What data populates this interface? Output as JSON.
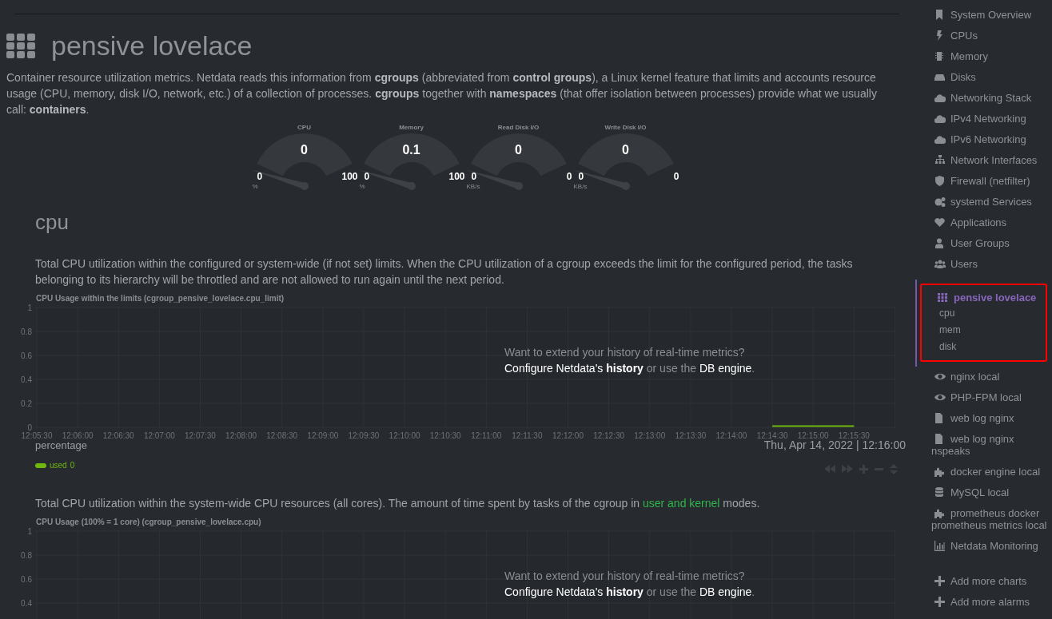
{
  "header": {
    "title": "pensive lovelace",
    "description": "Container resource utilization metrics. Netdata reads this information from **cgroups** (abbreviated from **control groups**), a Linux kernel feature that limits and accounts resource usage (CPU, memory, disk I/O, network, etc.) of a collection of processes. **cgroups** together with **namespaces** (that offer isolation between processes) provide what we usually call: **containers**."
  },
  "gauges": [
    {
      "title": "CPU",
      "value": "0",
      "min": "0",
      "max": "100",
      "unit": "%"
    },
    {
      "title": "Memory",
      "value": "0.1",
      "min": "0",
      "max": "100",
      "unit": "%"
    },
    {
      "title": "Read Disk I/O",
      "value": "0",
      "min": "0",
      "max": "0",
      "unit": "KB/s"
    },
    {
      "title": "Write Disk I/O",
      "value": "0",
      "min": "0",
      "max": "0",
      "unit": "KB/s"
    }
  ],
  "section": {
    "heading": "cpu"
  },
  "charts": [
    {
      "intro": {
        "text": "Total CPU utilization within the configured or system-wide (if not set) limits. When the CPU utilization of a cgroup exceeds the limit for the configured period, the tasks belonging to its hierarchy will be throttled and are not allowed to run again until the next period."
      },
      "history_notice": {
        "question": "Want to extend your history of real-time metrics?",
        "link_1": "Configure Netdata's **history**",
        "middle": " or use the ",
        "link_2": "DB engine",
        "end": "."
      },
      "units": "percentage",
      "timestamp": "Thu, Apr 14, 2022 | 12:16:00",
      "legend": [
        {
          "value": "0"
        }
      ],
      "chart_data": {
        "type": "line",
        "title": "CPU Usage within the limits (cgroup_pensive_lovelace.cpu_limit)",
        "categories": [
          "12:05:30",
          "12:06:00",
          "12:06:30",
          "12:07:00",
          "12:07:30",
          "12:08:00",
          "12:08:30",
          "12:09:00",
          "12:09:30",
          "12:10:00",
          "12:10:30",
          "12:11:00",
          "12:11:30",
          "12:12:00",
          "12:12:30",
          "12:13:00",
          "12:13:30",
          "12:14:00",
          "12:14:30",
          "12:15:00",
          "12:15:30"
        ],
        "series": [
          {
            "name": "used",
            "color": "#6fb70f",
            "values": [
              null,
              null,
              null,
              null,
              null,
              null,
              null,
              null,
              null,
              null,
              null,
              null,
              null,
              null,
              null,
              null,
              null,
              null,
              0,
              0,
              0
            ]
          }
        ],
        "ylim": [
          0,
          1
        ],
        "yticks": [
          0,
          0.2,
          0.4,
          0.6,
          0.8,
          1
        ],
        "grid": true
      }
    },
    {
      "intro": {
        "before": "Total CPU utilization within the system-wide CPU resources (all cores). The amount of time spent by tasks of the cgroup in ",
        "link": "user and kernel",
        "after": " modes."
      },
      "history_notice": {
        "question": "Want to extend your history of real-time metrics?",
        "link_1": "Configure Netdata's **history**",
        "middle": " or use the ",
        "link_2": "DB engine",
        "end": "."
      },
      "chart_title": "CPU Usage (100% = 1 core) (cgroup_pensive_lovelace.cpu)",
      "axis_labels": [
        "1",
        "0.8",
        "0.6",
        "0.4"
      ]
    }
  ],
  "sidebar": {
    "items": [
      {
        "label": "System Overview",
        "kind": "bookmark",
        "selected": false
      },
      {
        "label": "CPUs",
        "kind": "bolt",
        "selected": false
      },
      {
        "label": "Memory",
        "kind": "chip",
        "selected": false
      },
      {
        "label": "Disks",
        "kind": "drive",
        "selected": false
      },
      {
        "label": "Networking Stack",
        "kind": "cloud",
        "selected": false
      },
      {
        "label": "IPv4 Networking",
        "kind": "cloud",
        "selected": false
      },
      {
        "label": "IPv6 Networking",
        "kind": "cloud",
        "selected": false
      },
      {
        "label": "Network Interfaces",
        "kind": "sitemap",
        "selected": false
      },
      {
        "label": "Firewall (netfilter)",
        "kind": "shield",
        "selected": false
      },
      {
        "label": "systemd Services",
        "kind": "gears",
        "selected": false
      },
      {
        "label": "Applications",
        "kind": "heart",
        "selected": false
      },
      {
        "label": "User Groups",
        "kind": "user",
        "selected": false
      },
      {
        "label": "Users",
        "kind": "users",
        "selected": false
      },
      {
        "label": "pensive lovelace",
        "kind": "grid",
        "selected": true,
        "highlighted": true,
        "children": [
          {
            "label": "cpu"
          },
          {
            "label": "mem"
          },
          {
            "label": "disk"
          }
        ]
      },
      {
        "label": "nginx local",
        "kind": "eye",
        "selected": false
      },
      {
        "label": "PHP-FPM local",
        "kind": "eye",
        "selected": false
      },
      {
        "label": "web log nginx",
        "kind": "file",
        "selected": false
      },
      {
        "label": "web log nginx nspeaks",
        "kind": "file",
        "selected": false
      },
      {
        "label": "docker engine local",
        "kind": "puzzle",
        "selected": false
      },
      {
        "label": "MySQL local",
        "kind": "database",
        "selected": false
      },
      {
        "label": "prometheus docker prometheus metrics local",
        "kind": "puzzle",
        "selected": false
      },
      {
        "label": "Netdata Monitoring",
        "kind": "barchart",
        "selected": false
      }
    ],
    "actions": [
      {
        "label": "Add more charts",
        "kind": "plus"
      },
      {
        "label": "Add more alarms",
        "kind": "plus"
      }
    ]
  }
}
